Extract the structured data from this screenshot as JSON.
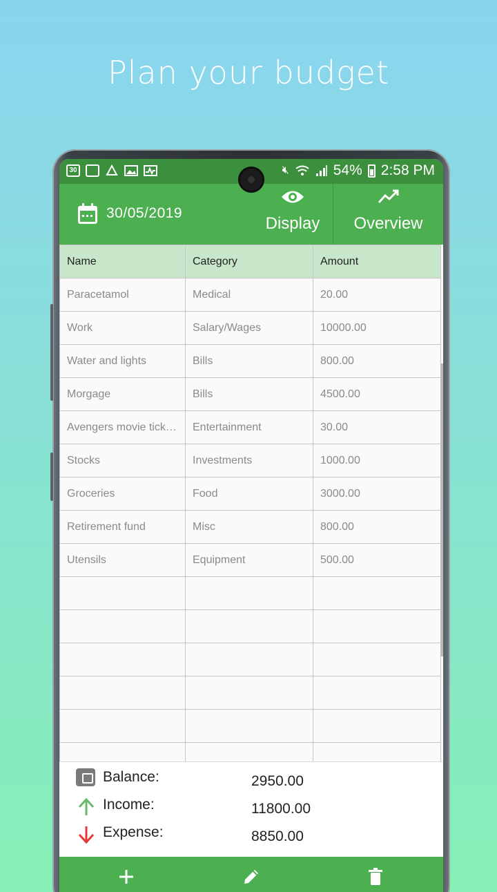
{
  "headline": "Plan your budget",
  "status_bar": {
    "left_icons": [
      "calendar-30-icon",
      "calendar-icon",
      "alert-icon",
      "gallery-icon",
      "activity-icon"
    ],
    "left_icon_text": "30",
    "battery": "54%",
    "time": "2:58 PM"
  },
  "app_bar": {
    "date": "30/05/2019",
    "tabs": [
      {
        "label": "Display",
        "icon": "eye-icon"
      },
      {
        "label": "Overview",
        "icon": "trending-up-icon"
      }
    ]
  },
  "table": {
    "columns": [
      "Name",
      "Category",
      "Amount"
    ],
    "rows": [
      [
        "Paracetamol",
        "Medical",
        "20.00"
      ],
      [
        "Work",
        "Salary/Wages",
        "10000.00"
      ],
      [
        "Water and lights",
        "Bills",
        "800.00"
      ],
      [
        "Morgage",
        "Bills",
        "4500.00"
      ],
      [
        "Avengers movie tick…",
        "Entertainment",
        "30.00"
      ],
      [
        "Stocks",
        "Investments",
        "1000.00"
      ],
      [
        "Groceries",
        "Food",
        "3000.00"
      ],
      [
        "Retirement fund",
        "Misc",
        "800.00"
      ],
      [
        "Utensils",
        "Equipment",
        "500.00"
      ]
    ],
    "empty_rows": 6
  },
  "summary": {
    "balance_label": "Balance:",
    "balance": "2950.00",
    "income_label": "Income:",
    "income": "11800.00",
    "expense_label": "Expense:",
    "expense": "8850.00"
  },
  "colors": {
    "primary": "#4caf50",
    "status_bar": "#3c8f3c",
    "header_row": "#c8e6c9",
    "income_arrow": "#66bb6a",
    "expense_arrow": "#e53935"
  },
  "bottom_actions": [
    "add-icon",
    "edit-icon",
    "delete-icon"
  ]
}
